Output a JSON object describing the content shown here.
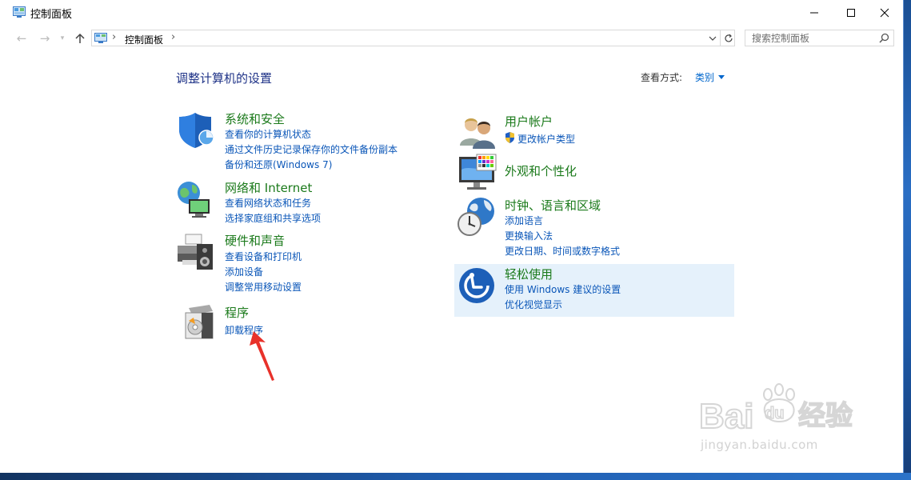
{
  "window": {
    "title": "控制面板",
    "controls": {
      "minimize": "minimize-icon",
      "maximize": "maximize-icon",
      "close": "close-icon"
    }
  },
  "nav": {
    "address_path": "控制面板",
    "search_placeholder": "搜索控制面板"
  },
  "main": {
    "page_title": "调整计算机的设置",
    "view_by_label": "查看方式:",
    "view_by_value": "类别"
  },
  "categories_left": [
    {
      "title": "系统和安全",
      "icon": "shield-icon",
      "links": [
        "查看你的计算机状态",
        "通过文件历史记录保存你的文件备份副本",
        "备份和还原(Windows 7)"
      ]
    },
    {
      "title": "网络和 Internet",
      "icon": "network-globe-icon",
      "links": [
        "查看网络状态和任务",
        "选择家庭组和共享选项"
      ]
    },
    {
      "title": "硬件和声音",
      "icon": "printer-speaker-icon",
      "links": [
        "查看设备和打印机",
        "添加设备",
        "调整常用移动设置"
      ]
    },
    {
      "title": "程序",
      "icon": "programs-disc-icon",
      "links": [
        "卸载程序"
      ]
    }
  ],
  "categories_right": [
    {
      "title": "用户帐户",
      "icon": "users-icon",
      "links": [
        "更改帐户类型"
      ]
    },
    {
      "title": "外观和个性化",
      "icon": "monitor-palette-icon",
      "links": []
    },
    {
      "title": "时钟、语言和区域",
      "icon": "clock-globe-icon",
      "links": [
        "添加语言",
        "更换输入法",
        "更改日期、时间或数字格式"
      ]
    },
    {
      "title": "轻松使用",
      "icon": "ease-of-access-icon",
      "links": [
        "使用 Windows 建议的设置",
        "优化视觉显示"
      ]
    }
  ],
  "colors": {
    "title_blue": "#1e3287",
    "category_green": "#1b7a1b",
    "link_blue": "#0a56b8",
    "highlight": "#e5f1fb",
    "annotation_red": "#e8312a"
  },
  "watermark": {
    "brand": "Baidu经验",
    "url": "jingyan.baidu.com"
  }
}
